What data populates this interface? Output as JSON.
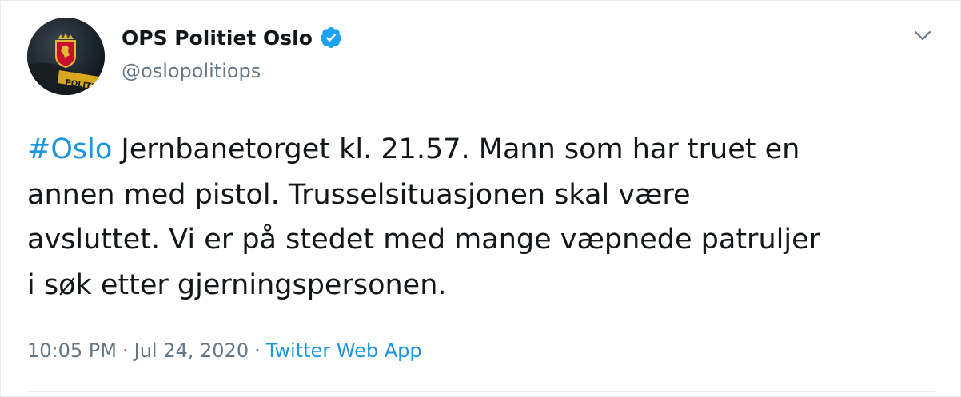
{
  "author": {
    "display_name": "OPS Politiet Oslo",
    "handle": "@oslopolitiops",
    "verified": true,
    "avatar_label": "POLITI"
  },
  "tweet": {
    "hashtag": "#Oslo",
    "line1_rest": " Jernbanetorget kl. 21.57. Mann som har truet en",
    "line2": "annen med pistol. Trusselsituasjonen skal være",
    "line3": "avsluttet. Vi er på stedet med mange væpnede patruljer",
    "line4": "i søk etter gjerningspersonen."
  },
  "meta": {
    "time": "10:05 PM",
    "date": "Jul 24, 2020",
    "separator": "·",
    "source": "Twitter Web App"
  },
  "colors": {
    "link": "#1b95e0",
    "muted": "#657786",
    "text": "#14171a",
    "verified": "#1da1f2"
  },
  "icons": {
    "verified": "verified-badge-icon",
    "menu": "chevron-down-icon"
  }
}
